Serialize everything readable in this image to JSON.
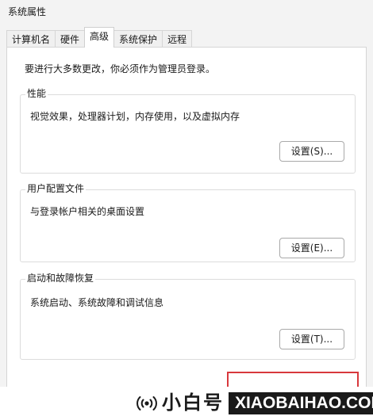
{
  "window": {
    "title": "系统属性"
  },
  "tabs": [
    {
      "label": "计算机名",
      "active": false
    },
    {
      "label": "硬件",
      "active": false
    },
    {
      "label": "高级",
      "active": true
    },
    {
      "label": "系统保护",
      "active": false
    },
    {
      "label": "远程",
      "active": false
    }
  ],
  "advanced": {
    "admin_note": "要进行大多数更改，你必须作为管理员登录。",
    "performance": {
      "title": "性能",
      "description": "视觉效果，处理器计划，内存使用，以及虚拟内存",
      "button": "设置(S)..."
    },
    "user_profiles": {
      "title": "用户配置文件",
      "description": "与登录帐户相关的桌面设置",
      "button": "设置(E)..."
    },
    "startup_recovery": {
      "title": "启动和故障恢复",
      "description": "系统启动、系统故障和调试信息",
      "button": "设置(T)..."
    }
  },
  "watermark": {
    "icon": "signal-broadcast-icon",
    "text_cn": "小白号",
    "text_en": "XIAOBAIHAO.COM"
  },
  "colors": {
    "highlight_border": "#d8383c",
    "watermark_dark": "#1a1a1a"
  }
}
